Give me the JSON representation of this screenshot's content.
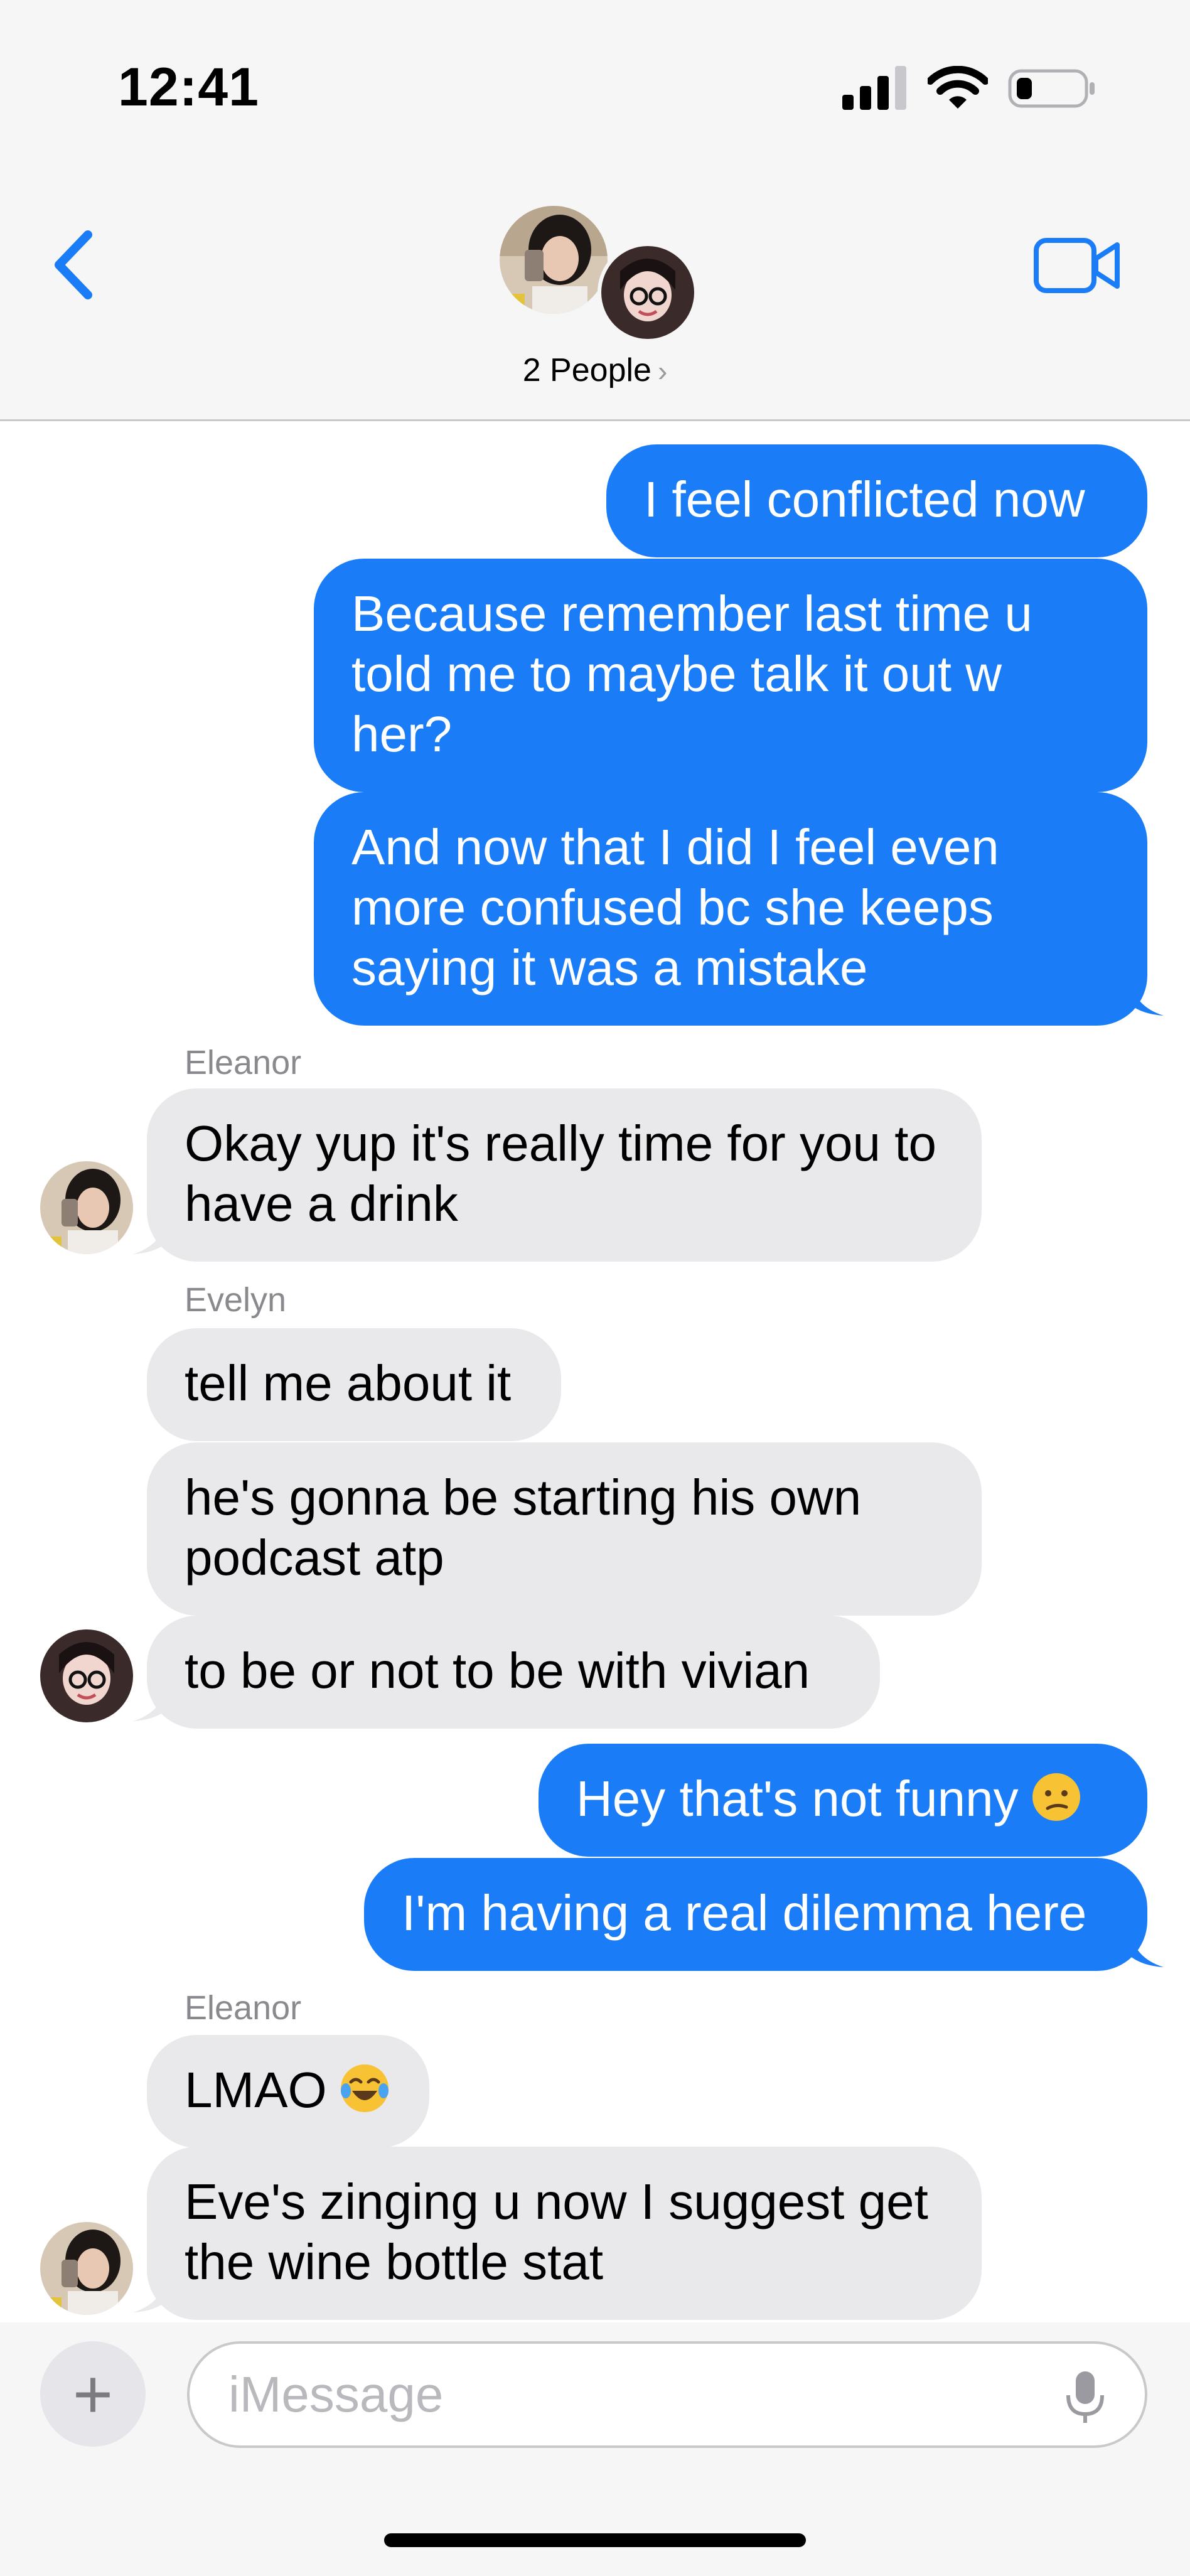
{
  "status_bar": {
    "time": "12:41"
  },
  "header": {
    "people_label": "2 People"
  },
  "messages": [
    {
      "text": "I feel conflicted now"
    },
    {
      "text": "Because remember last time u told me to maybe talk it out w her?"
    },
    {
      "text": "And now that I did I feel even more confused bc she keeps saying it was a mistake"
    },
    {
      "sender": "Eleanor",
      "text": "Okay yup it's really time for you to have a drink"
    },
    {
      "sender": "Evelyn",
      "text": "tell me about it"
    },
    {
      "text": "he's gonna be starting his own podcast atp"
    },
    {
      "text": "to be or not to be with vivian"
    },
    {
      "text": "Hey that's not funny",
      "emoji": "confused-face"
    },
    {
      "text": "I'm having a real dilemma here"
    },
    {
      "sender": "Eleanor",
      "text": "LMAO",
      "emoji": "tears-of-joy"
    },
    {
      "text": "Eve's zinging u now I suggest get the wine bottle stat"
    }
  ],
  "compose": {
    "placeholder": "iMessage"
  },
  "colors": {
    "sent_bubble": "#1a7cf6",
    "received_bubble": "#e9e9eb",
    "accent": "#1a7cf6"
  }
}
